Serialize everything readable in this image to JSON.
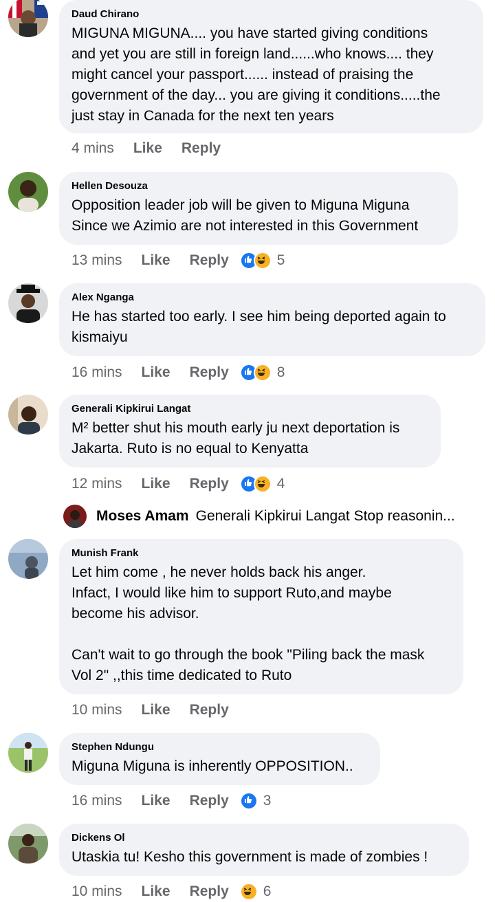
{
  "comments": [
    {
      "name": "Daud Chirano",
      "text": "MIGUNA MIGUNA.... you have started  giving conditions\nand yet you are still in foreign land......who knows.... they\nmight cancel your passport...... instead of praising the\ngovernment of the day... you are giving it conditions.....the\njust stay in Canada for the next ten years",
      "time": "4 mins",
      "like": "Like",
      "reply": "Reply",
      "reactions": [],
      "reaction_count": ""
    },
    {
      "name": "Hellen Desouza",
      "text": "Opposition leader job will be given to Miguna Miguna\nSince we Azimio are not interested in this Government",
      "time": "13 mins",
      "like": "Like",
      "reply": "Reply",
      "reactions": [
        "like",
        "haha"
      ],
      "reaction_count": "5"
    },
    {
      "name": "Alex Nganga",
      "text": "He has started too early. I see him being deported again to\nkismaiyu",
      "time": "16 mins",
      "like": "Like",
      "reply": "Reply",
      "reactions": [
        "like",
        "haha"
      ],
      "reaction_count": "8"
    },
    {
      "name": "Generali Kipkirui Langat",
      "text": "M² better shut his mouth early ju next deportation is\nJakarta. Ruto is no equal to Kenyatta",
      "time": "12 mins",
      "like": "Like",
      "reply": "Reply",
      "reactions": [
        "like",
        "haha"
      ],
      "reaction_count": "4"
    },
    {
      "name": "Munish Frank",
      "text": "Let him come , he  never holds back his anger.\nInfact, I would like him to support Ruto,and maybe\nbecome his advisor.\n\nCan't wait to go through the book \"Piling back the mask\nVol 2\" ,,this time dedicated to Ruto",
      "time": "10 mins",
      "like": "Like",
      "reply": "Reply",
      "reactions": [],
      "reaction_count": ""
    },
    {
      "name": "Stephen Ndungu",
      "text": "Miguna Miguna is inherently OPPOSITION..",
      "time": "16 mins",
      "like": "Like",
      "reply": "Reply",
      "reactions": [
        "like"
      ],
      "reaction_count": "3"
    },
    {
      "name": "Dickens Ol",
      "text": "Utaskia tu! Kesho this government is made of zombies !",
      "time": "10 mins",
      "like": "Like",
      "reply": "Reply",
      "reactions": [
        "haha"
      ],
      "reaction_count": "6"
    }
  ],
  "nested_reply": {
    "name": "Moses Amam",
    "text": "Generali Kipkirui Langat Stop reasonin..."
  },
  "colors": {
    "bubble": "#f0f2f5",
    "meta_text": "#65676b",
    "like_blue": "#1877f2",
    "haha_yellow": "#f7b125"
  }
}
